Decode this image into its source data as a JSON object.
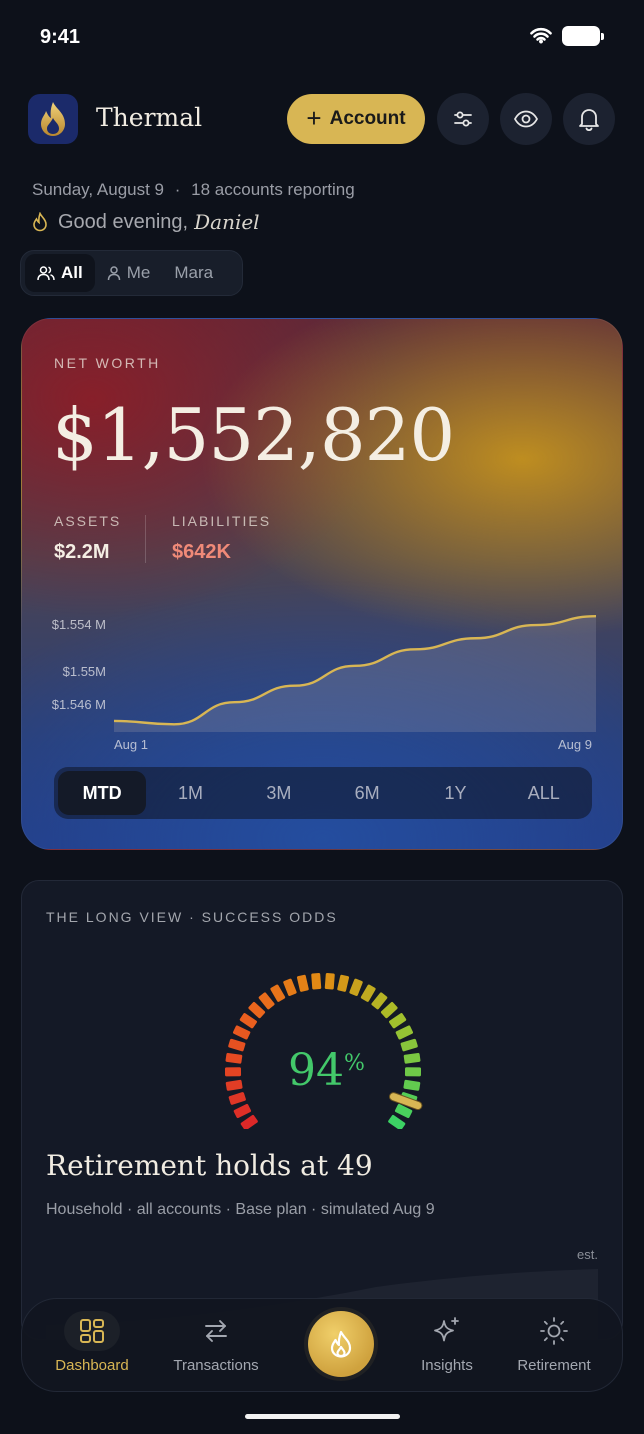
{
  "status": {
    "time": "9:41"
  },
  "header": {
    "brand": "Thermal",
    "add_account_label": "Account",
    "date": "Sunday, August 9",
    "accounts_reporting": "18 accounts reporting",
    "greeting": "Good evening,",
    "user_name": "Daniel"
  },
  "filter": {
    "items": [
      {
        "label": "All",
        "active": true
      },
      {
        "label": "Me",
        "active": false
      },
      {
        "label": "Mara",
        "active": false
      }
    ]
  },
  "net_worth": {
    "label": "NET WORTH",
    "value": "$1,552,820",
    "assets_label": "ASSETS",
    "assets_value": "$2.2M",
    "liabilities_label": "LIABILITIES",
    "liabilities_value": "$642K",
    "colors": {
      "liabilities": "#f08a78",
      "line": "#d8b654"
    }
  },
  "chart_data": {
    "type": "area",
    "x_labels": [
      "Aug 1",
      "Aug 9"
    ],
    "y_tick_labels": [
      "$1.554 M",
      "$1.55M",
      "$1.546 M"
    ],
    "y_ticks": [
      1.554,
      1.55,
      1.546
    ],
    "ylim": [
      1.5448,
      1.5555
    ],
    "x": [
      0,
      0.125,
      0.25,
      0.375,
      0.5,
      0.625,
      0.75,
      0.875,
      1
    ],
    "values": [
      1.5458,
      1.5455,
      1.5475,
      1.549,
      1.5508,
      1.5523,
      1.5533,
      1.5545,
      1.5553
    ]
  },
  "ranges": [
    {
      "label": "MTD",
      "active": true
    },
    {
      "label": "1M",
      "active": false
    },
    {
      "label": "3M",
      "active": false
    },
    {
      "label": "6M",
      "active": false
    },
    {
      "label": "1Y",
      "active": false
    },
    {
      "label": "ALL",
      "active": false
    }
  ],
  "long_view": {
    "label": "THE LONG VIEW · SUCCESS ODDS",
    "odds_value": "94",
    "odds_unit": "%",
    "odds_fraction": 0.94,
    "title": "Retirement holds at 49",
    "subtitle": "Household · all accounts · Base plan · simulated Aug 9",
    "est_label": "est."
  },
  "tabs": [
    {
      "label": "Dashboard",
      "icon": "dashboard-icon",
      "active": true
    },
    {
      "label": "Transactions",
      "icon": "transactions-icon",
      "active": false
    },
    {
      "label": "Insights",
      "icon": "sparkle-icon",
      "active": false
    },
    {
      "label": "Retirement",
      "icon": "sun-icon",
      "active": false
    }
  ]
}
